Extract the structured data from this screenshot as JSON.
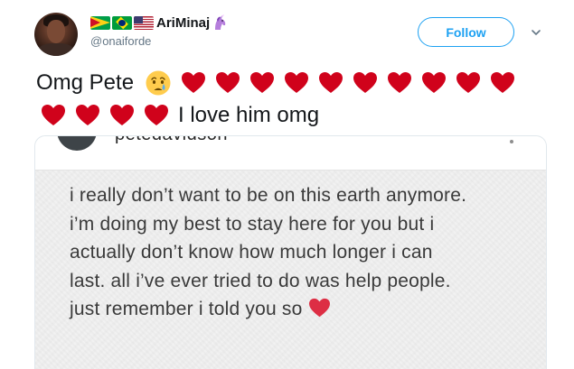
{
  "tweet": {
    "author": {
      "display_name": "AriMinaj",
      "handle": "@onaiforde",
      "flags": [
        "guyana-flag",
        "brazil-flag",
        "usa-flag"
      ],
      "emoji_after_name": "unicorn-icon"
    },
    "follow_label": "Follow",
    "caret_icon": "chevron-down-icon",
    "text": {
      "line1_prefix": "Omg Pete",
      "line1_emoji": "crying-face-icon",
      "line1_hearts": 10,
      "line2_hearts": 4,
      "line2_suffix": "I love him omg"
    }
  },
  "attached_photo": {
    "cut_username": "petedavidson",
    "note_lines": [
      "i really don’t want to be on this earth anymore.",
      "i’m doing my best to stay here for you but i",
      "actually don’t know how much longer i can",
      "last. all i’ve ever tried to do was help people.",
      "just remember i told you so"
    ],
    "note_emoji": "red-heart-icon"
  },
  "colors": {
    "accent": "#1da1f2",
    "heart": "#d0021b",
    "text": "#14171a",
    "muted": "#657786"
  }
}
